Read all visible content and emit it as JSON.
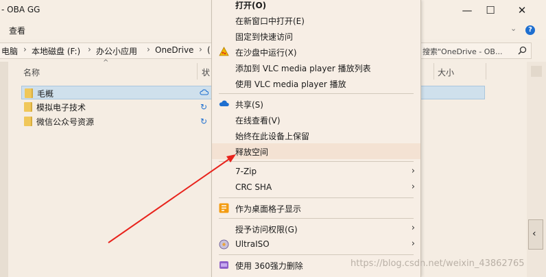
{
  "window": {
    "title": "- OBA GG",
    "minimize_glyph": "—",
    "maximize_glyph": "☐",
    "close_glyph": "✕"
  },
  "ribbon": {
    "tab_view": "查看",
    "expand_glyph": "⌄",
    "help_glyph": "?"
  },
  "address": {
    "crumbs": [
      "电脑",
      "本地磁盘 (F:)",
      "办公小应用",
      "OneDrive",
      "("
    ],
    "separator": "›"
  },
  "search": {
    "placeholder": "搜索\"OneDrive - OB..."
  },
  "columns": {
    "name": "名称",
    "status": "状",
    "size": "大小",
    "sort_glyph": "^"
  },
  "files": [
    {
      "name": "毛概",
      "status_icon": "cloud-icon",
      "selected": true
    },
    {
      "name": "模拟电子技术",
      "status_icon": "sync-icon",
      "selected": false
    },
    {
      "name": "微信公众号资源",
      "status_icon": "sync-icon",
      "selected": false
    }
  ],
  "sync_glyph": "↻",
  "context_menu": {
    "items": [
      {
        "label": "打开(O)",
        "bold": true
      },
      {
        "label": "在新窗口中打开(E)"
      },
      {
        "label": "固定到快速访问"
      },
      {
        "label": "在沙盘中运行(X)",
        "icon": "sandbox-icon"
      },
      {
        "label": "添加到 VLC media player 播放列表"
      },
      {
        "label": "使用 VLC media player 播放"
      },
      {
        "label": "共享(S)",
        "icon": "onedrive-icon"
      },
      {
        "label": "在线查看(V)"
      },
      {
        "label": "始终在此设备上保留"
      },
      {
        "label": "释放空间",
        "hovered": true
      },
      {
        "label": "7-Zip",
        "submenu": true
      },
      {
        "label": "CRC SHA",
        "submenu": true
      },
      {
        "label": "作为桌面格子显示",
        "icon": "grid-icon"
      },
      {
        "label": "授予访问权限(G)",
        "submenu": true
      },
      {
        "label": "UltraISO",
        "icon": "ultraiso-icon",
        "submenu": true
      },
      {
        "label": "使用 360强力删除",
        "icon": "360-delete-icon"
      }
    ],
    "submenu_glyph": "›"
  },
  "colors": {
    "accent_blue": "#1e6fd0",
    "selection": "#cfe0ec",
    "annotation_arrow": "#e8231c"
  },
  "watermark": "https://blog.csdn.net/weixin_43862765"
}
